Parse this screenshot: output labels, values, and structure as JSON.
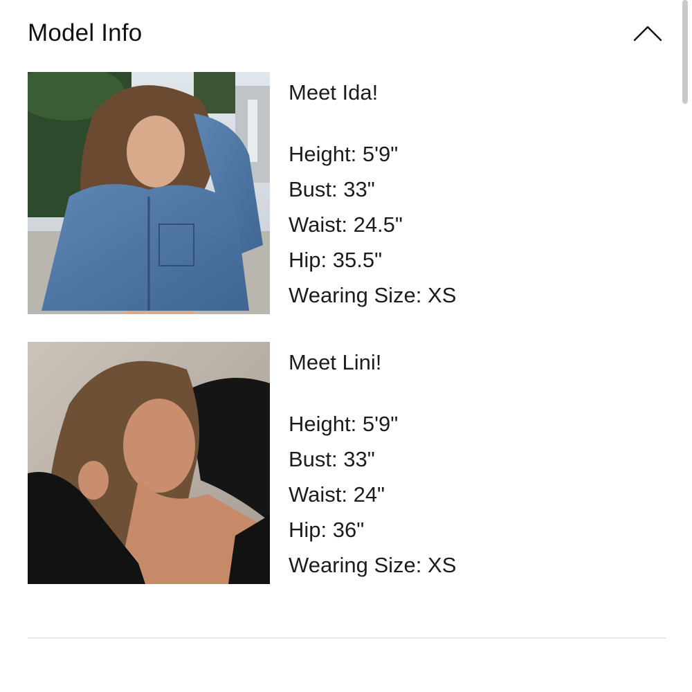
{
  "header": {
    "title": "Model Info",
    "toggle_icon": "chevron-up-icon"
  },
  "models": [
    {
      "intro": "Meet Ida!",
      "height": "Height: 5'9\"",
      "bust": "Bust: 33\"",
      "waist": "Waist: 24.5\"",
      "hip": "Hip: 35.5\"",
      "size": "Wearing Size: XS",
      "photo_icon": "model-photo-denim-jacket"
    },
    {
      "intro": "Meet Lini!",
      "height": "Height: 5'9\"",
      "bust": "Bust: 33\"",
      "waist": "Waist: 24\"",
      "hip": "Hip: 36\"",
      "size": "Wearing Size: XS",
      "photo_icon": "model-photo-black-top"
    }
  ],
  "colors": {
    "text": "#1c1c1c",
    "divider": "#e6e6e6",
    "background": "#ffffff"
  }
}
